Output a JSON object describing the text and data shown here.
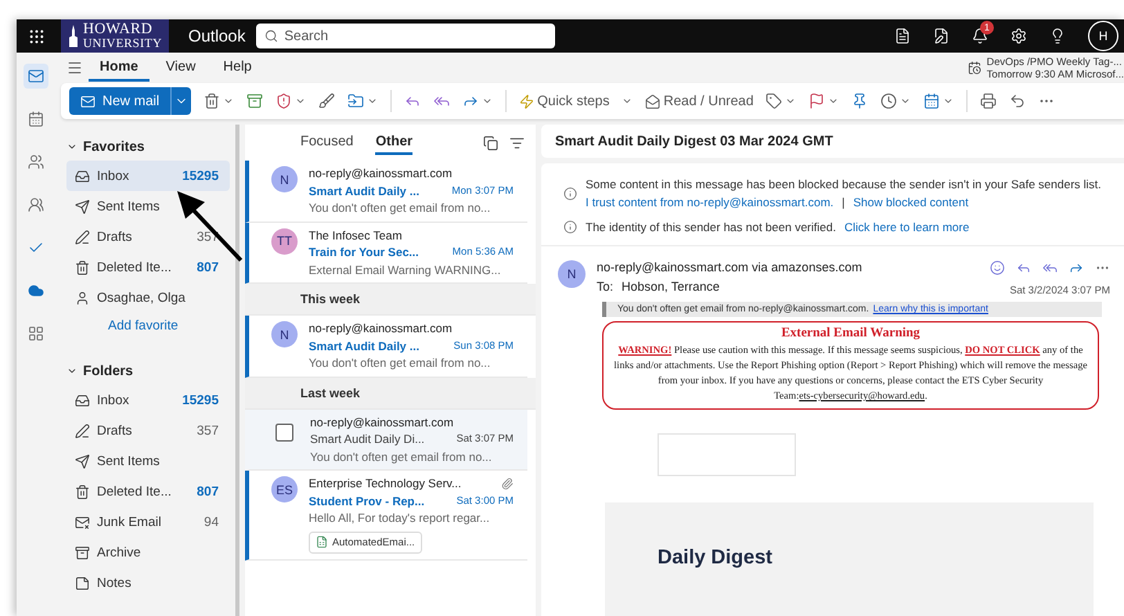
{
  "top_bar": {
    "logo_line1": "HOWARD",
    "logo_line2": "UNIVERSITY",
    "app_name": "Outlook",
    "search_placeholder": "Search",
    "notification_count": "1",
    "avatar": "H"
  },
  "rail": [
    {
      "kind": "mail",
      "selected": true
    },
    {
      "kind": "calendar",
      "selected": false
    },
    {
      "kind": "people",
      "selected": false
    },
    {
      "kind": "groups",
      "selected": false
    },
    {
      "kind": "todo",
      "selected": false
    },
    {
      "kind": "onedrive",
      "selected": false
    },
    {
      "kind": "apps",
      "selected": false
    }
  ],
  "ribbon": {
    "tabs": [
      {
        "label": "Home",
        "selected": true
      },
      {
        "label": "View",
        "selected": false
      },
      {
        "label": "Help",
        "selected": false
      }
    ],
    "reminder": {
      "title": "DevOps /PMO Weekly Tag-...",
      "subtitle": "Tomorrow 9:30 AM Microsof..."
    },
    "new_mail": "New mail",
    "quick_steps": "Quick steps",
    "read_unread": "Read / Unread"
  },
  "folders": {
    "sections": [
      {
        "heading": "Favorites",
        "expanded": true,
        "items": [
          {
            "kind": "inbox",
            "label": "Inbox",
            "count": "15295",
            "unread": true,
            "selected": true
          },
          {
            "kind": "sent",
            "label": "Sent Items",
            "selected": false
          },
          {
            "kind": "drafts",
            "label": "Drafts",
            "count": "357",
            "unread": false,
            "selected": false
          },
          {
            "kind": "deleted",
            "label": "Deleted Ite...",
            "count": "807",
            "unread": true,
            "selected": false
          },
          {
            "kind": "person",
            "label": "Osaghae, Olga",
            "selected": false
          }
        ],
        "add_link": "Add favorite"
      },
      {
        "heading": "Folders",
        "expanded": true,
        "items": [
          {
            "kind": "inbox",
            "label": "Inbox",
            "count": "15295",
            "unread": true,
            "selected": false
          },
          {
            "kind": "drafts",
            "label": "Drafts",
            "count": "357",
            "unread": false,
            "selected": false
          },
          {
            "kind": "sent",
            "label": "Sent Items",
            "selected": false
          },
          {
            "kind": "deleted",
            "label": "Deleted Ite...",
            "count": "807",
            "unread": true,
            "selected": false
          },
          {
            "kind": "junk",
            "label": "Junk Email",
            "count": "94",
            "unread": false,
            "selected": false
          },
          {
            "kind": "archive",
            "label": "Archive",
            "selected": false
          },
          {
            "kind": "notes",
            "label": "Notes",
            "selected": false
          }
        ]
      }
    ]
  },
  "message_list": {
    "tabs": [
      {
        "label": "Focused",
        "selected": false
      },
      {
        "label": "Other",
        "selected": true
      }
    ],
    "items": [
      {
        "kind": "message",
        "avatar": "N",
        "color": "#a3aef0",
        "sender": "no-reply@kainossmart.com",
        "subject": "Smart Audit Daily ...",
        "time": "Mon 3:07 PM",
        "preview": "You don't often get email from no...",
        "unread": true
      },
      {
        "kind": "message",
        "avatar": "TT",
        "color": "#d99ccb",
        "sender": "The Infosec Team",
        "subject": "Train for Your Sec...",
        "time": "Mon 5:36 AM",
        "preview": "External Email Warning WARNING...",
        "unread": true
      },
      {
        "kind": "group",
        "label": "This week"
      },
      {
        "kind": "message",
        "avatar": "N",
        "color": "#a3aef0",
        "sender": "no-reply@kainossmart.com",
        "subject": "Smart Audit Daily ...",
        "time": "Sun 3:08 PM",
        "preview": "You don't often get email from no...",
        "unread": true
      },
      {
        "kind": "group",
        "label": "Last week"
      },
      {
        "kind": "message",
        "checked": false,
        "sender": "no-reply@kainossmart.com",
        "subject": "Smart Audit Daily Di...",
        "time": "Sat 3:07 PM",
        "preview": "You don't often get email from no...",
        "unread": false
      },
      {
        "kind": "message",
        "avatar": "ES",
        "color": "#a3aef0",
        "sender": "Enterprise Technology Serv...",
        "subject": "Student Prov - Rep...",
        "time": "Sat 3:00 PM",
        "preview": "Hello All, For today's report regar...",
        "unread": true,
        "attachment": "AutomatedEmai..."
      }
    ]
  },
  "reading_pane": {
    "subject": "Smart Audit Daily Digest 03 Mar 2024 GMT",
    "blocked_notice": "Some content in this message has been blocked because the sender isn't in your Safe senders list.",
    "trust_link": "I trust content from no-reply@kainossmart.com.",
    "separator": "|",
    "show_blocked_link": "Show blocked content",
    "identity_notice": "The identity of this sender has not been verified.",
    "learn_more_link": "Click here to learn more",
    "sender_avatar": {
      "initials": "N",
      "color": "#a3aef0"
    },
    "from": "no-reply@kainossmart.com via amazonses.com",
    "to_label": "To:",
    "to": "Hobson, Terrance",
    "date": "Sat 3/2/2024 3:07 PM",
    "first_contact": "You don't often get email from no-reply@kainossmart.com.",
    "first_contact_link": "Learn why this is important",
    "warning": {
      "title": "External Email Warning",
      "text": "**WARNING!** Please use caution with this message. If this message seems suspicious, **DO NOT CLICK** any of the links and/or attachments. Use the Report Phishing option (Report > Report Phishing) which will remove the message from your inbox. If you have any questions or concerns, please contact the ETS Cyber Security Team:",
      "email": "ets-cybersecurity@howard.edu",
      "end": "."
    },
    "digest_heading": "Daily Digest"
  }
}
